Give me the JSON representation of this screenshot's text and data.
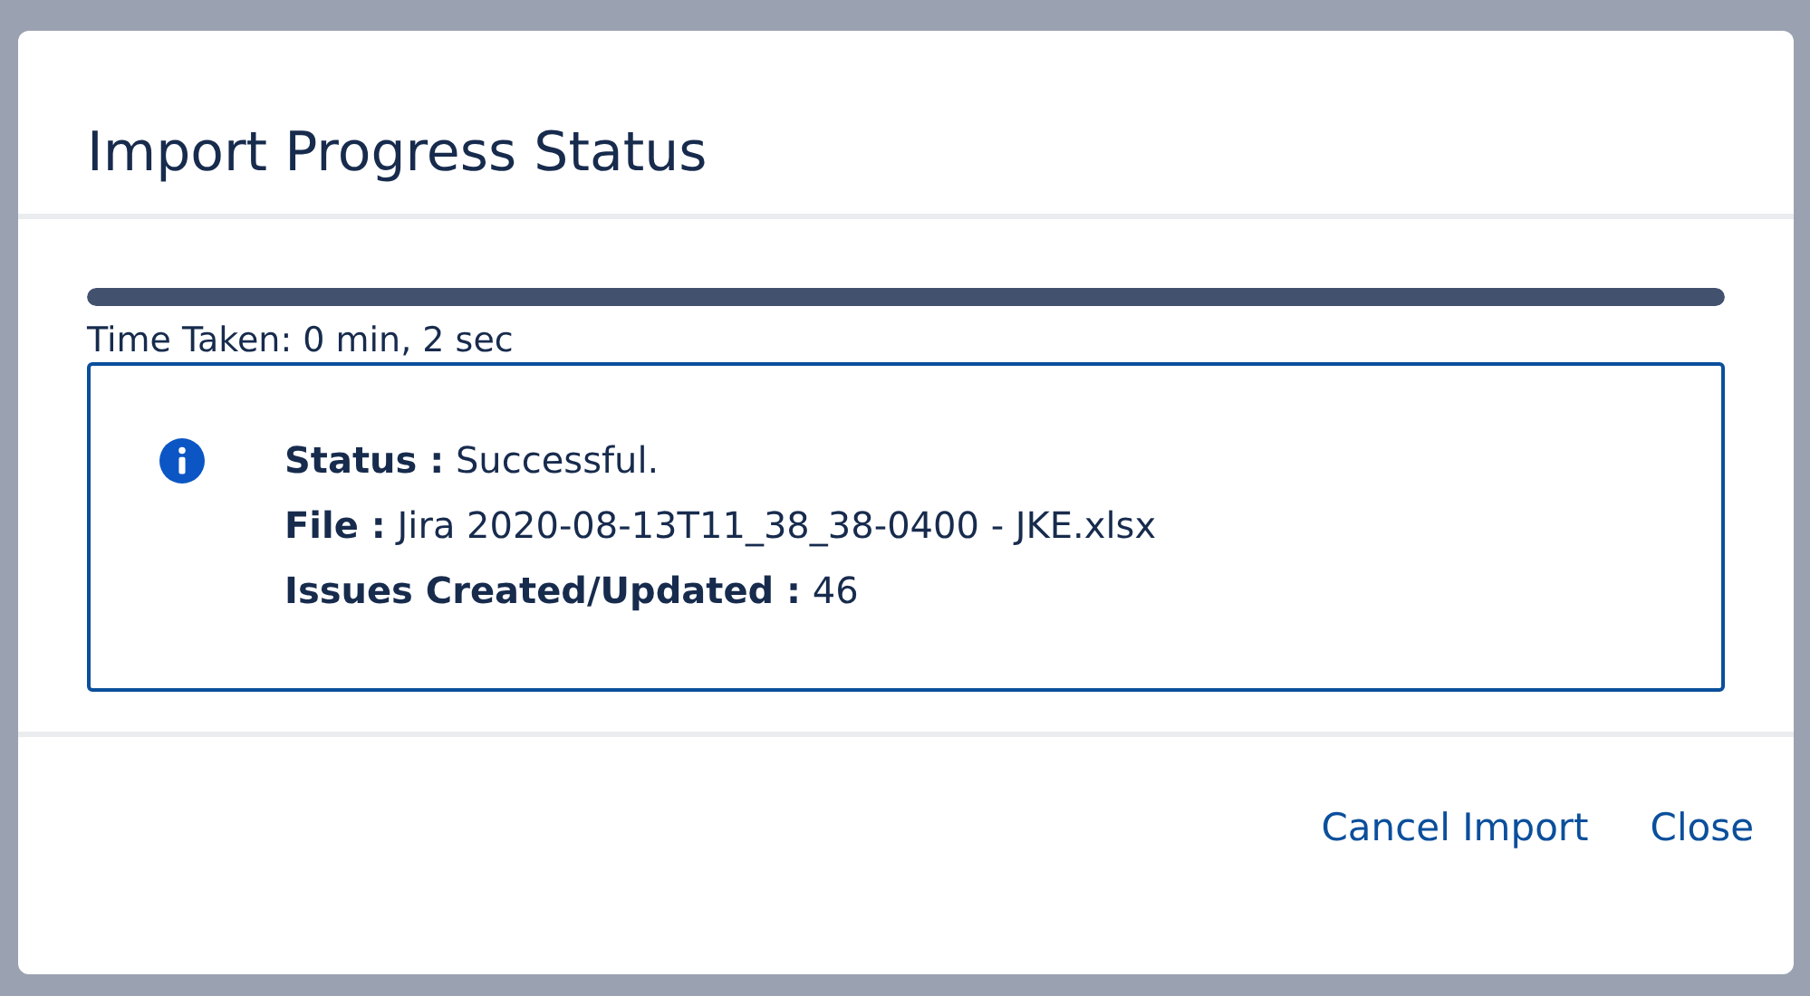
{
  "dialog": {
    "title": "Import Progress Status"
  },
  "progress": {
    "level": 1,
    "time_taken": "Time Taken: 0 min, 2 sec"
  },
  "message": {
    "kind": "info",
    "lines": [
      {
        "label": "Status :",
        "value": "Successful."
      },
      {
        "label": "File :",
        "value": "Jira 2020-08-13T11_38_38-0400 - JKE.xlsx"
      },
      {
        "label": "Issues Created/Updated :",
        "value": "46"
      }
    ]
  },
  "buttons": [
    "Cancel Import",
    "Close"
  ]
}
